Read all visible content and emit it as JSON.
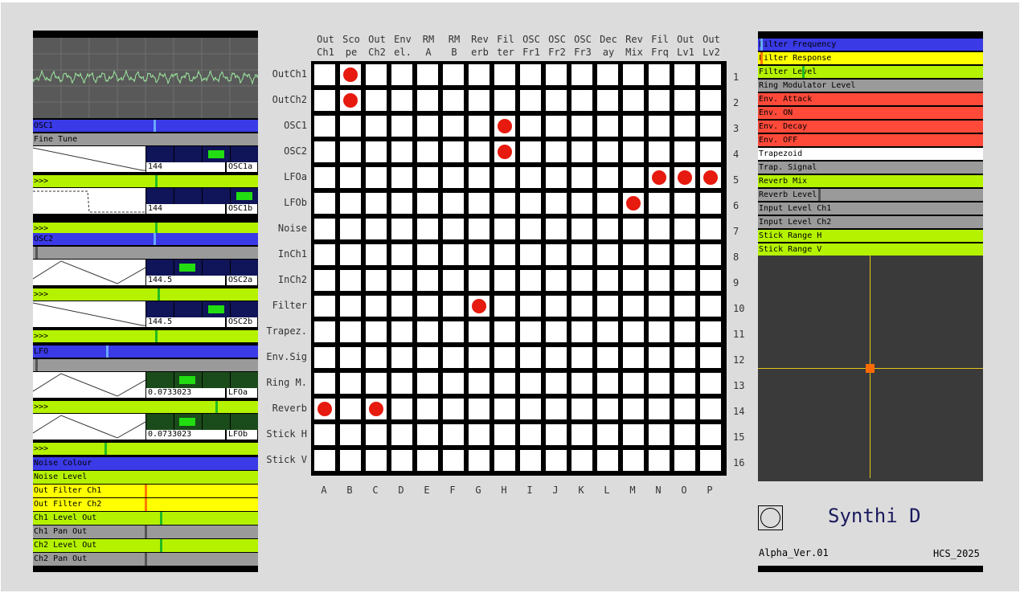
{
  "colors": {
    "blue": "#3a3ae6",
    "gray": "#9a9a9a",
    "lime": "#b5f200",
    "yellow": "#ffff00",
    "red": "#ff4a3a",
    "white": "#ffffff",
    "pin": "#e61a0e",
    "scopeTrace": "#9de8a0",
    "navy": "#101458",
    "darkgreen": "#1a4b1a"
  },
  "left": {
    "rows": [
      {
        "label": "OSC1",
        "color": "blue",
        "indicator": 0.54,
        "indColor": "#6aa8ff"
      },
      {
        "label": "Fine Tune",
        "color": "gray",
        "indicator": null
      },
      {
        "label": ">>>",
        "color": "lime",
        "indicator": 0.55,
        "indColor": "#22bb22"
      },
      {
        "label": ">>>",
        "color": "lime",
        "indicator": 0.55,
        "indColor": "#22bb22"
      },
      {
        "label": "OSC2",
        "color": "blue",
        "indicator": 0.54,
        "indColor": "#6aa8ff"
      },
      {
        "label": "",
        "color": "gray",
        "indicator": 0.01,
        "indColor": "#555555"
      },
      {
        "label": ">>>",
        "color": "lime",
        "indicator": 0.56,
        "indColor": "#22bb22"
      },
      {
        "label": ">>>",
        "color": "lime",
        "indicator": 0.55,
        "indColor": "#22bb22"
      },
      {
        "label": "LFO",
        "color": "blue",
        "indicator": 0.33,
        "indColor": "#6aa8ff"
      },
      {
        "label": "",
        "color": "gray",
        "indicator": 0.01,
        "indColor": "#555555"
      },
      {
        "label": ">>>",
        "color": "lime",
        "indicator": 0.82,
        "indColor": "#22bb22"
      },
      {
        "label": ">>>",
        "color": "lime",
        "indicator": 0.32,
        "indColor": "#22bb22"
      },
      {
        "label": "Noise Colour",
        "color": "blue",
        "indicator": null
      },
      {
        "label": "Noise Level",
        "color": "lime",
        "indicator": null
      },
      {
        "label": "Out Filter Ch1",
        "color": "yellow",
        "indicator": 0.5,
        "indColor": "#ff7a00"
      },
      {
        "label": "Out Filter Ch2",
        "color": "yellow",
        "indicator": 0.5,
        "indColor": "#ff7a00"
      },
      {
        "label": "Ch1 Level Out",
        "color": "lime",
        "indicator": 0.57,
        "indColor": "#22bb22"
      },
      {
        "label": "Ch1 Pan Out",
        "color": "gray",
        "indicator": 0.5,
        "indColor": "#555555"
      },
      {
        "label": "Ch2 Level Out",
        "color": "lime",
        "indicator": 0.57,
        "indColor": "#22bb22"
      },
      {
        "label": "Ch2 Pan Out",
        "color": "gray",
        "indicator": 0.5,
        "indColor": "#555555"
      }
    ],
    "oscillators": [
      {
        "value": "144",
        "name": "OSC1a",
        "wave": "saw-down",
        "screen": "navy",
        "bright": 3
      },
      {
        "value": "144",
        "name": "OSC1b",
        "wave": "pulse",
        "screen": "navy",
        "bright": 4
      },
      {
        "value": "144.5",
        "name": "OSC2a",
        "wave": "triangle",
        "screen": "navy",
        "bright": 1
      },
      {
        "value": "144.5",
        "name": "OSC2b",
        "wave": "saw-down",
        "screen": "navy",
        "bright": 3
      },
      {
        "value": "0.0733023",
        "name": "LFOa",
        "wave": "triangle",
        "screen": "darkgreen",
        "bright": 1
      },
      {
        "value": "0.0733023",
        "name": "LFOb",
        "wave": "triangle",
        "screen": "darkgreen",
        "bright": 1
      }
    ]
  },
  "matrix": {
    "col_headers": [
      [
        "Out",
        "Ch1"
      ],
      [
        "Sco",
        "pe"
      ],
      [
        "Out",
        "Ch2"
      ],
      [
        "Env",
        "el."
      ],
      [
        "RM",
        "A"
      ],
      [
        "RM",
        "B"
      ],
      [
        "Rev",
        "erb"
      ],
      [
        "Fil",
        "ter"
      ],
      [
        "OSC",
        "Fr1"
      ],
      [
        "OSC",
        "Fr2"
      ],
      [
        "OSC",
        "Fr3"
      ],
      [
        "Dec",
        "ay"
      ],
      [
        "Rev",
        "Mix"
      ],
      [
        "Fil",
        "Frq"
      ],
      [
        "Out",
        "Lv1"
      ],
      [
        "Out",
        "Lv2"
      ]
    ],
    "row_headers": [
      "OutCh1",
      "OutCh2",
      "OSC1",
      "OSC2",
      "LFOa",
      "LFOb",
      "Noise",
      "InCh1",
      "InCh2",
      "Filter",
      "Trapez.",
      "Env.Sig",
      "Ring M.",
      "Reverb",
      "Stick H",
      "Stick V"
    ],
    "row_numbers": [
      "1",
      "2",
      "3",
      "4",
      "5",
      "6",
      "7",
      "8",
      "9",
      "10",
      "11",
      "12",
      "13",
      "14",
      "15",
      "16"
    ],
    "col_letters": [
      "A",
      "B",
      "C",
      "D",
      "E",
      "F",
      "G",
      "H",
      "I",
      "J",
      "K",
      "L",
      "M",
      "N",
      "O",
      "P"
    ],
    "pins": [
      [
        0,
        1
      ],
      [
        1,
        1
      ],
      [
        2,
        7
      ],
      [
        3,
        7
      ],
      [
        4,
        13
      ],
      [
        4,
        14
      ],
      [
        4,
        15
      ],
      [
        5,
        12
      ],
      [
        9,
        6
      ],
      [
        13,
        0
      ],
      [
        13,
        2
      ]
    ]
  },
  "right": {
    "rows": [
      {
        "label": "Filter Frequency",
        "color": "blue",
        "indicator": 0.01,
        "indColor": "#6aa8ff"
      },
      {
        "label": "Filter Response",
        "color": "yellow",
        "indicator": 0.01,
        "indColor": "#ff7a00"
      },
      {
        "label": "Filter Level",
        "color": "lime",
        "indicator": 0.2,
        "indColor": "#22bb22"
      },
      {
        "label": "Ring Modulator Level",
        "color": "gray",
        "indicator": null
      },
      {
        "label": "Env. Attack",
        "color": "red",
        "indicator": null
      },
      {
        "label": "Env. ON",
        "color": "red",
        "indicator": null
      },
      {
        "label": "Env. Decay",
        "color": "red",
        "indicator": null
      },
      {
        "label": "Env. OFF",
        "color": "red",
        "indicator": null
      },
      {
        "label": "Trapezoid",
        "color": "white",
        "indicator": null
      },
      {
        "label": "Trap. Signal",
        "color": "gray",
        "indicator": null
      },
      {
        "label": "Reverb Mix",
        "color": "lime",
        "indicator": null
      },
      {
        "label": "Reverb Level",
        "color": "gray",
        "indicator": 0.27,
        "indColor": "#555555"
      },
      {
        "label": "Input Level Ch1",
        "color": "gray",
        "indicator": null
      },
      {
        "label": "Input Level Ch2",
        "color": "gray",
        "indicator": null
      },
      {
        "label": "Stick Range H",
        "color": "lime",
        "indicator": null
      },
      {
        "label": "Stick Range V",
        "color": "lime",
        "indicator": null
      }
    ],
    "stick": {
      "h": 0.5,
      "v": 0.5
    }
  },
  "footer": {
    "title": "Synthi D",
    "version": "Alpha_Ver.01",
    "credit": "HCS_2025"
  }
}
